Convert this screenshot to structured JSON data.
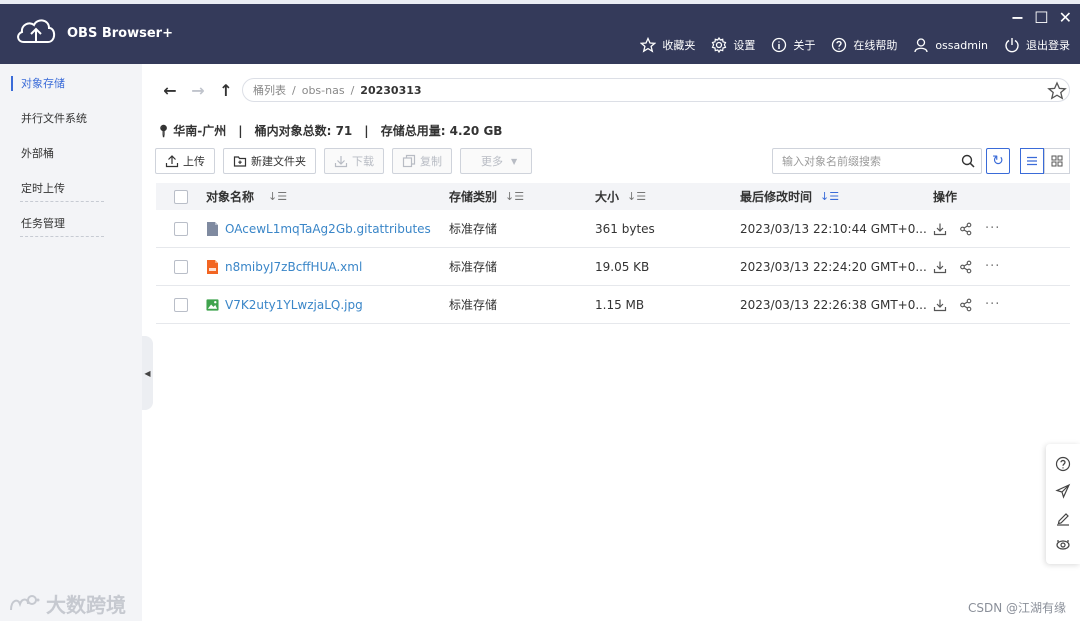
{
  "app": {
    "title": "OBS Browser+"
  },
  "window_controls": {
    "minimize": "−",
    "maximize": "☐",
    "close": "✕"
  },
  "header_menu": {
    "favorites": "收藏夹",
    "settings": "设置",
    "about": "关于",
    "help": "在线帮助",
    "user": "ossadmin",
    "logout": "退出登录"
  },
  "sidebar": {
    "items": [
      {
        "label": "对象存储"
      },
      {
        "label": "并行文件系统"
      },
      {
        "label": "外部桶"
      },
      {
        "label": "定时上传"
      },
      {
        "label": "任务管理"
      }
    ],
    "watermark": "大数跨境"
  },
  "breadcrumb": {
    "root": "桶列表",
    "sep": "/",
    "bucket": "obs-nas",
    "current": "20230313"
  },
  "bucket_info": {
    "region": "华南-广州",
    "object_count": "桶内对象总数: 71",
    "storage_used": "存储总用量: 4.20 GB",
    "separator": "|"
  },
  "toolbar": {
    "upload": "上传",
    "new_folder": "新建文件夹",
    "download": "下载",
    "copy": "复制",
    "more": "更多"
  },
  "search": {
    "placeholder": "输入对象名前缀搜索"
  },
  "table": {
    "headers": {
      "name": "对象名称",
      "storage_class": "存储类别",
      "size": "大小",
      "modified": "最后修改时间",
      "actions": "操作"
    },
    "rows": [
      {
        "name": "OAcewL1mqTaAg2Gb.gitattributes",
        "storage_class": "标准存储",
        "size": "361 bytes",
        "modified": "2023/03/13 22:10:44 GMT+0...",
        "file_type": "generic-file-icon"
      },
      {
        "name": "n8mibyJ7zBcffHUA.xml",
        "storage_class": "标准存储",
        "size": "19.05 KB",
        "modified": "2023/03/13 22:24:20 GMT+0...",
        "file_type": "xml-file-icon"
      },
      {
        "name": "V7K2uty1YLwzjaLQ.jpg",
        "storage_class": "标准存储",
        "size": "1.15 MB",
        "modified": "2023/03/13 22:26:38 GMT+0...",
        "file_type": "image-file-icon"
      }
    ]
  },
  "footer": {
    "credit": "CSDN @江湖有缘"
  },
  "colors": {
    "header_bg": "#343a5a",
    "accent": "#3a6bd8",
    "link": "#3a86c8",
    "xml_icon": "#f26522",
    "image_icon": "#3fa34d"
  }
}
